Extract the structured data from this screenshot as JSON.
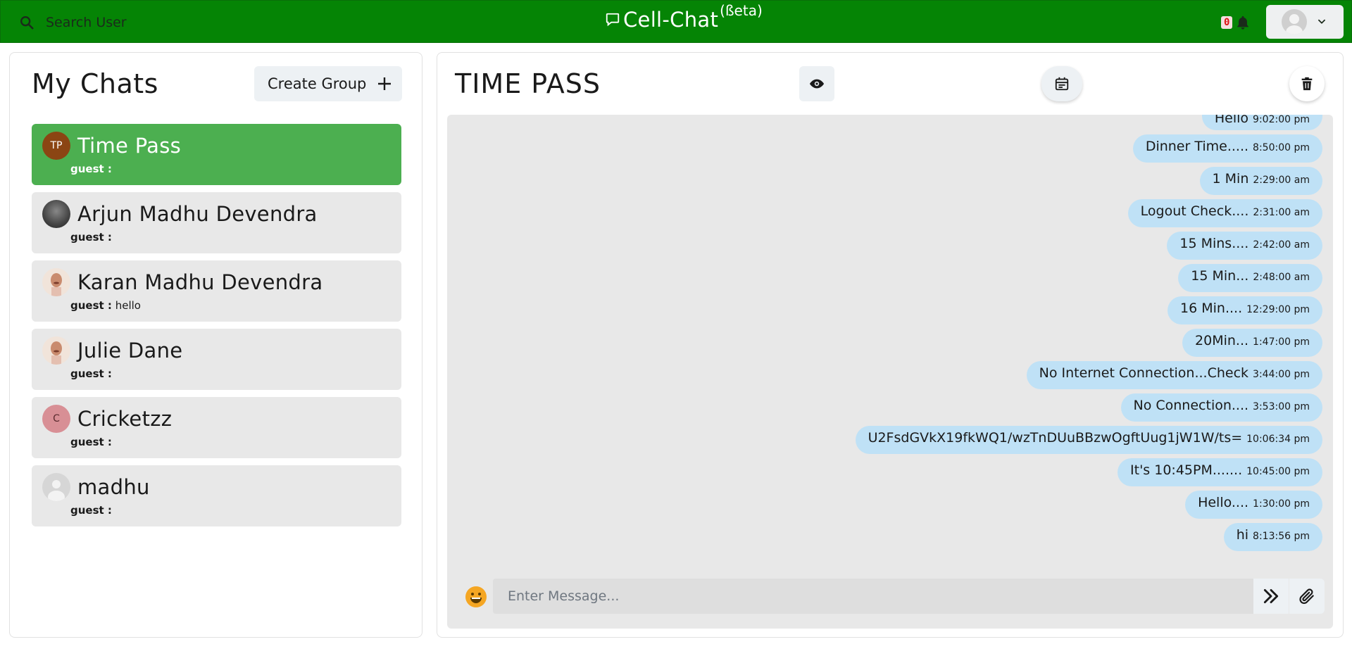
{
  "header": {
    "search_label": "Search User",
    "app_title": "Cell-Chat",
    "app_beta": "(ßeta)",
    "notification_count": "0"
  },
  "sidebar": {
    "title": "My Chats",
    "create_group_label": "Create Group",
    "chats": [
      {
        "name": "Time Pass",
        "initials": "TP",
        "sender": "guest :",
        "last_message": "",
        "avatar_color": "#8b4513",
        "active": true
      },
      {
        "name": "Arjun Madhu Devendra",
        "initials": "",
        "sender": "guest :",
        "last_message": "",
        "avatar_color": "#555555",
        "active": false
      },
      {
        "name": "Karan Madhu Devendra",
        "initials": "",
        "sender": "guest :",
        "last_message": "hello",
        "avatar_color": "#e8cdb8",
        "active": false
      },
      {
        "name": "Julie Dane",
        "initials": "",
        "sender": "guest :",
        "last_message": "",
        "avatar_color": "#e8cdb8",
        "active": false
      },
      {
        "name": "Cricketzz",
        "initials": "C",
        "sender": "guest :",
        "last_message": "",
        "avatar_color": "#d88f95",
        "active": false
      },
      {
        "name": "madhu",
        "initials": "",
        "sender": "guest :",
        "last_message": "",
        "avatar_color": "#d6d6d6",
        "active": false
      }
    ]
  },
  "chat": {
    "title": "TIME PASS",
    "messages": [
      {
        "text": "Hello",
        "time": "9:02:00 pm"
      },
      {
        "text": "Dinner Time.....",
        "time": "8:50:00 pm"
      },
      {
        "text": "1 Min",
        "time": "2:29:00 am"
      },
      {
        "text": "Logout Check....",
        "time": "2:31:00 am"
      },
      {
        "text": "15 Mins....",
        "time": "2:42:00 am"
      },
      {
        "text": "15 Min...",
        "time": "2:48:00 am"
      },
      {
        "text": "16 Min....",
        "time": "12:29:00 pm"
      },
      {
        "text": "20Min...",
        "time": "1:47:00 pm"
      },
      {
        "text": "No Internet Connection...Check",
        "time": "3:44:00 pm"
      },
      {
        "text": "No Connection....",
        "time": "3:53:00 pm"
      },
      {
        "text": "U2FsdGVkX19fkWQ1/wzTnDUuBBzwOgftUug1jW1W/ts=",
        "time": "10:06:34 pm"
      },
      {
        "text": "It's 10:45PM.......",
        "time": "10:45:00 pm"
      },
      {
        "text": "Hello....",
        "time": "1:30:00 pm"
      },
      {
        "text": "hi",
        "time": "8:13:56 pm"
      }
    ],
    "input_placeholder": "Enter Message..."
  },
  "colors": {
    "header_green": "#058405",
    "active_chat": "#4caf50",
    "bubble": "#bfe1f6",
    "emoji": "#f5a623"
  }
}
